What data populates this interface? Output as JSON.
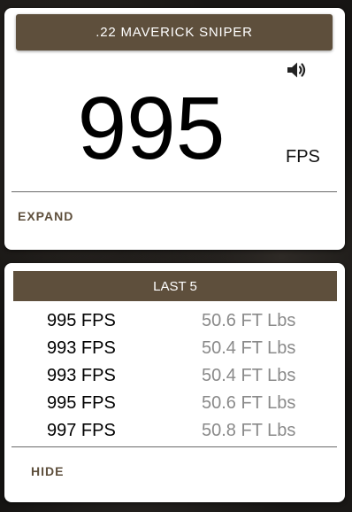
{
  "current": {
    "title": ".22 MAVERICK SNIPER",
    "speed": "995",
    "unit": "FPS",
    "sound_icon": "volume-icon",
    "expand_label": "EXPAND"
  },
  "history": {
    "title": "LAST 5",
    "hide_label": "HIDE",
    "shots": [
      {
        "fps": "995 FPS",
        "energy": "50.6 FT Lbs"
      },
      {
        "fps": "993 FPS",
        "energy": "50.4 FT Lbs"
      },
      {
        "fps": "993 FPS",
        "energy": "50.4 FT Lbs"
      },
      {
        "fps": "995 FPS",
        "energy": "50.6 FT Lbs"
      },
      {
        "fps": "997 FPS",
        "energy": "50.8 FT Lbs"
      }
    ]
  },
  "colors": {
    "accent": "#5e4f3c",
    "card": "#ffffff",
    "secondary_text": "#8a8a8a"
  }
}
